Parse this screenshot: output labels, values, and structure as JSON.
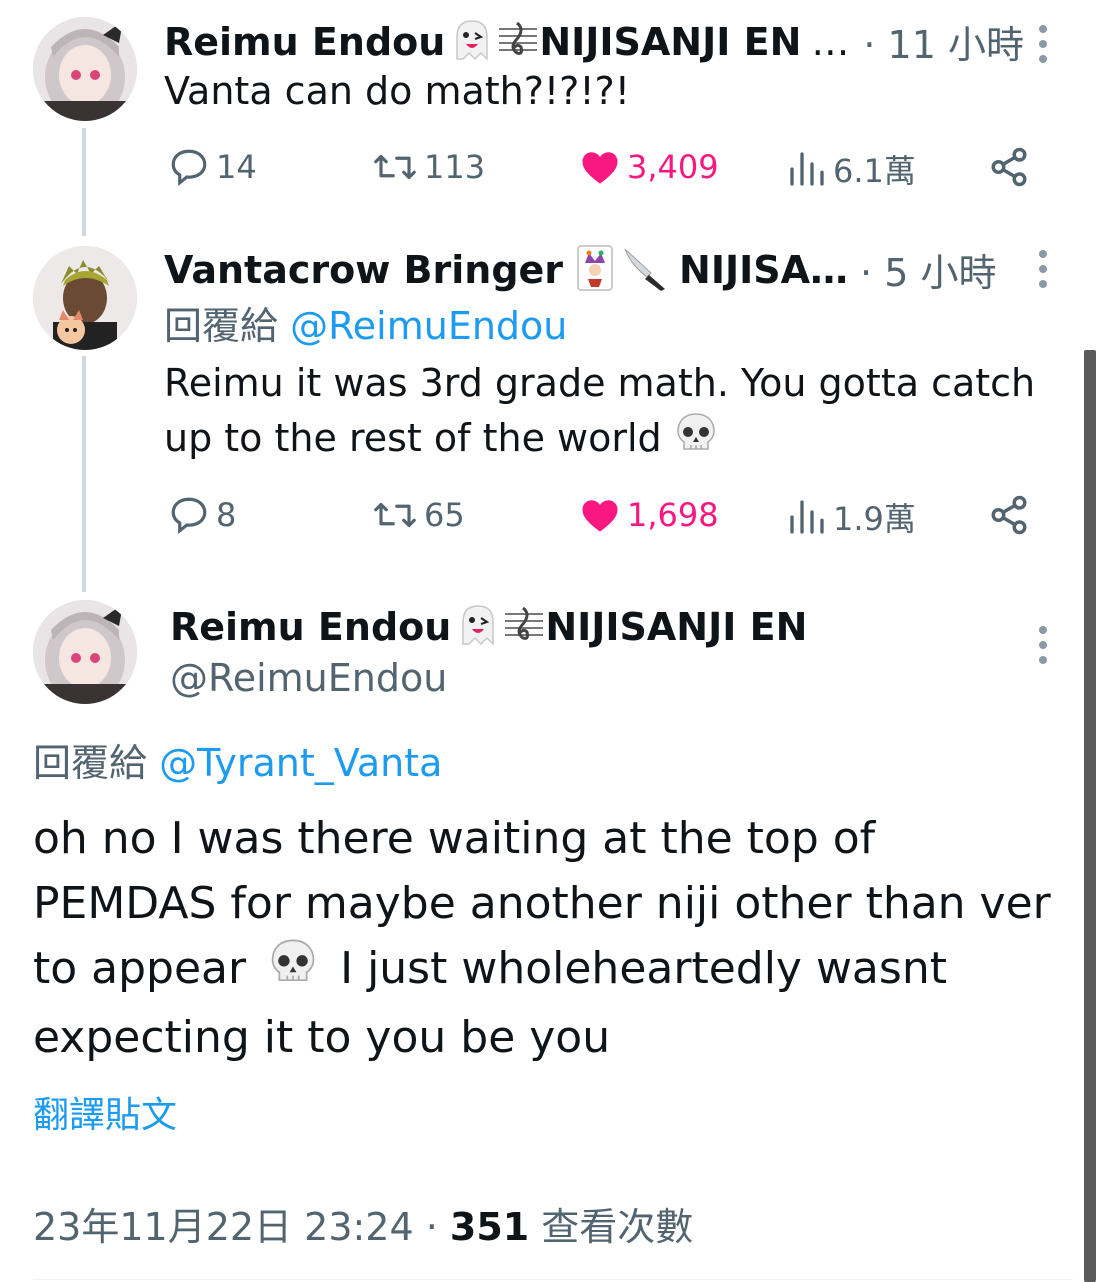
{
  "tweet1": {
    "name": "Reimu Endou",
    "name_suffix": "NIJISANJI EN",
    "ellipsis": "…",
    "time": "· 11 小時",
    "text": "Vanta can do math?!?!?!",
    "replies": "14",
    "retweets": "113",
    "likes": "3,409",
    "views": "6.1萬"
  },
  "tweet2": {
    "name": "Vantacrow Bringer",
    "name_suffix": "NIJISA…",
    "time": "· 5 小時",
    "reply_prefix": "回覆給",
    "reply_to": "@ReimuEndou",
    "text": "Reimu it was 3rd grade math. You gotta catch up to the rest of the world",
    "replies": "8",
    "retweets": "65",
    "likes": "1,698",
    "views": "1.9萬"
  },
  "main_tweet": {
    "name": "Reimu Endou",
    "name_suffix": "NIJISANJI EN",
    "handle": "@ReimuEndou",
    "reply_prefix": "回覆給",
    "reply_to": "@Tyrant_Vanta",
    "text_part1": "oh no I was there waiting at the top of PEMDAS for maybe another niji other than ver to appear",
    "text_part2": "I just wholeheartedly wasnt expecting it to you be you",
    "translate": "翻譯貼文",
    "timestamp": "23年11月22日 23:24 · ",
    "view_count": "351",
    "view_label": " 查看次數"
  },
  "colors": {
    "accent": "#1d9bf0",
    "like": "#f91880",
    "muted": "#536471",
    "thread_line": "#cfd9de"
  },
  "icons": [
    "ghost-emoji",
    "music-score-emoji",
    "joker-card-emoji",
    "knife-emoji",
    "skull-emoji",
    "reply-icon",
    "retweet-icon",
    "heart-icon",
    "views-icon",
    "share-icon",
    "more-icon"
  ]
}
